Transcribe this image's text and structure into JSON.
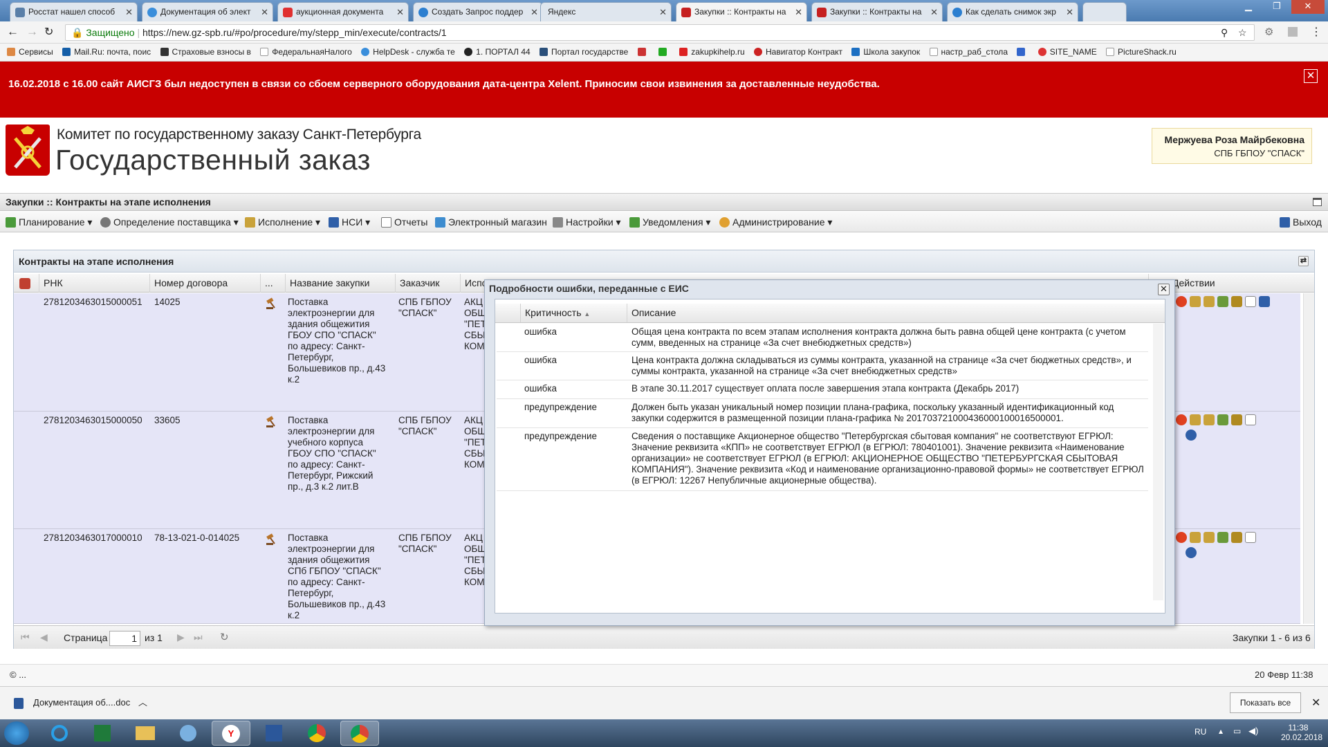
{
  "browser": {
    "tabs": [
      {
        "title": "Росстат нашел способ"
      },
      {
        "title": "Документация об элект"
      },
      {
        "title": "аукционная документа"
      },
      {
        "title": "Создать Запрос поддер"
      },
      {
        "title": "Яндекс"
      },
      {
        "title": "Закупки :: Контракты на"
      },
      {
        "title": "Закупки :: Контракты на"
      },
      {
        "title": "Как сделать снимок экр"
      }
    ],
    "secure_label": "Защищено",
    "url": "https://new.gz-spb.ru/#po/procedure/my/stepp_min/execute/contracts/1",
    "bookmarks": [
      "Сервисы",
      "Mail.Ru: почта, поис",
      "Страховые взносы в",
      "ФедеральнаяНалого",
      "HelpDesk - служба те",
      "1. ПОРТАЛ 44",
      "Портал государстве",
      "",
      "",
      "zakupkihelp.ru",
      "Навигатор Контракт",
      "Школа закупок",
      "настр_раб_стола",
      "",
      "SITE_NAME",
      "PictureShack.ru"
    ]
  },
  "banner": {
    "text": "16.02.2018 с 16.00 сайт АИСГЗ был недоступен в связи со сбоем серверного оборудования дата-центра Xelent. Приносим свои извинения за доставленные неудобства.",
    "close": "✕"
  },
  "header": {
    "org_small": "Комитет по государственному заказу Санкт-Петербурга",
    "org_big": "Государственный заказ",
    "user_name": "Мержуева Роза Майрбековна",
    "user_org": "СПБ ГБПОУ \"СПАСК\""
  },
  "page_title": "Закупки :: Контракты на этапе исполнения",
  "menu": {
    "items": [
      "Планирование",
      "Определение поставщика",
      "Исполнение",
      "НСИ",
      "Отчеты",
      "Электронный магазин",
      "Настройки",
      "Уведомления",
      "Администрирование"
    ],
    "exit": "Выход"
  },
  "grid": {
    "title": "Контракты на этапе исполнения",
    "columns": [
      "РНК",
      "Номер договора",
      "...",
      "Название закупки",
      "Заказчик",
      "Испо",
      "Действии"
    ],
    "rows": [
      {
        "rnk": "2781203463015000051",
        "contract": "14025",
        "name": [
          "Поставка",
          "электроэнергии для",
          "здания общежития",
          "ГБОУ СПО \"СПАСК\"",
          "по адресу: Санкт-",
          "Петербург,",
          "Большевиков пр., д.43",
          "к.2"
        ],
        "customer": [
          "СПБ ГБПОУ",
          "\"СПАСК\""
        ],
        "executor": [
          "АКЦ",
          "ОБЩ",
          "\"ПЕТ",
          "СБЫ",
          "КОМ"
        ]
      },
      {
        "rnk": "2781203463015000050",
        "contract": "33605",
        "name": [
          "Поставка",
          "электроэнергии для",
          "учебного корпуса",
          "ГБОУ СПО \"СПАСК\"",
          "по адресу: Санкт-",
          "Петербург, Рижский",
          "пр., д.3 к.2 лит.В"
        ],
        "customer": [
          "СПБ ГБПОУ",
          "\"СПАСК\""
        ],
        "executor": [
          "АКЦ",
          "ОБЩ",
          "\"ПЕТ",
          "СБЫ",
          "КОМ"
        ]
      },
      {
        "rnk": "2781203463017000010",
        "contract": "78-13-021-0-014025",
        "name": [
          "Поставка",
          "электроэнергии для",
          "здания общежития",
          "СПб ГБПОУ \"СПАСК\"",
          "по адресу: Санкт-",
          "Петербург,",
          "Большевиков пр., д.43",
          "к.2"
        ],
        "customer": [
          "СПБ ГБПОУ",
          "\"СПАСК\""
        ],
        "executor": [
          "АКЦ",
          "ОБЩ",
          "\"ПЕТ",
          "СБЫ",
          "КОМ"
        ]
      }
    ],
    "pager": {
      "page_label": "Страница",
      "page": "1",
      "of": "из 1",
      "summary": "Закупки 1 - 6 из 6"
    }
  },
  "modal": {
    "title": "Подробности ошибки, переданные с ЕИС",
    "close": "✕",
    "columns": [
      "Критичность",
      "Описание"
    ],
    "rows": [
      {
        "level": "ошибка",
        "text": "Общая цена контракта по всем этапам исполнения контракта должна быть равна общей цене контракта (с учетом сумм, введенных на странице «За счет внебюджетных средств»)"
      },
      {
        "level": "ошибка",
        "text": "Цена контракта должна складываться из суммы контракта, указанной на странице «За счет бюджетных средств», и суммы контракта, указанной на странице «За счет внебюджетных средств»"
      },
      {
        "level": "ошибка",
        "text": "В этапе 30.11.2017 существует оплата после завершения этапа контракта (Декабрь 2017)"
      },
      {
        "level": "предупреждение",
        "text": "Должен быть указан уникальный номер позиции плана-графика, поскольку указанный идентификационный код закупки содержится в размещенной позиции плана-графика № 201703721000436000100016500001."
      },
      {
        "level": "предупреждение",
        "text": "Сведения о поставщике Акционерное общество \"Петербургская сбытовая компания\" не соответствуют ЕГРЮЛ: Значение реквизита «КПП» не соответствует ЕГРЮЛ (в ЕГРЮЛ: 780401001). Значение реквизита «Наименование организации» не соответствует ЕГРЮЛ (в ЕГРЮЛ: АКЦИОНЕРНОЕ ОБЩЕСТВО \"ПЕТЕРБУРГСКАЯ СБЫТОВАЯ КОМПАНИЯ\"). Значение реквизита «Код и наименование организационно-правовой формы» не соответствует ЕГРЮЛ (в ЕГРЮЛ: 12267 Непубличные акционерные общества)."
      }
    ]
  },
  "footer": {
    "left": "© ...",
    "right": "20 Февр 11:38"
  },
  "download": {
    "file": "Документация об....doc",
    "show_all": "Показать все"
  },
  "taskbar": {
    "lang": "RU",
    "time": "11:38",
    "date": "20.02.2018"
  }
}
